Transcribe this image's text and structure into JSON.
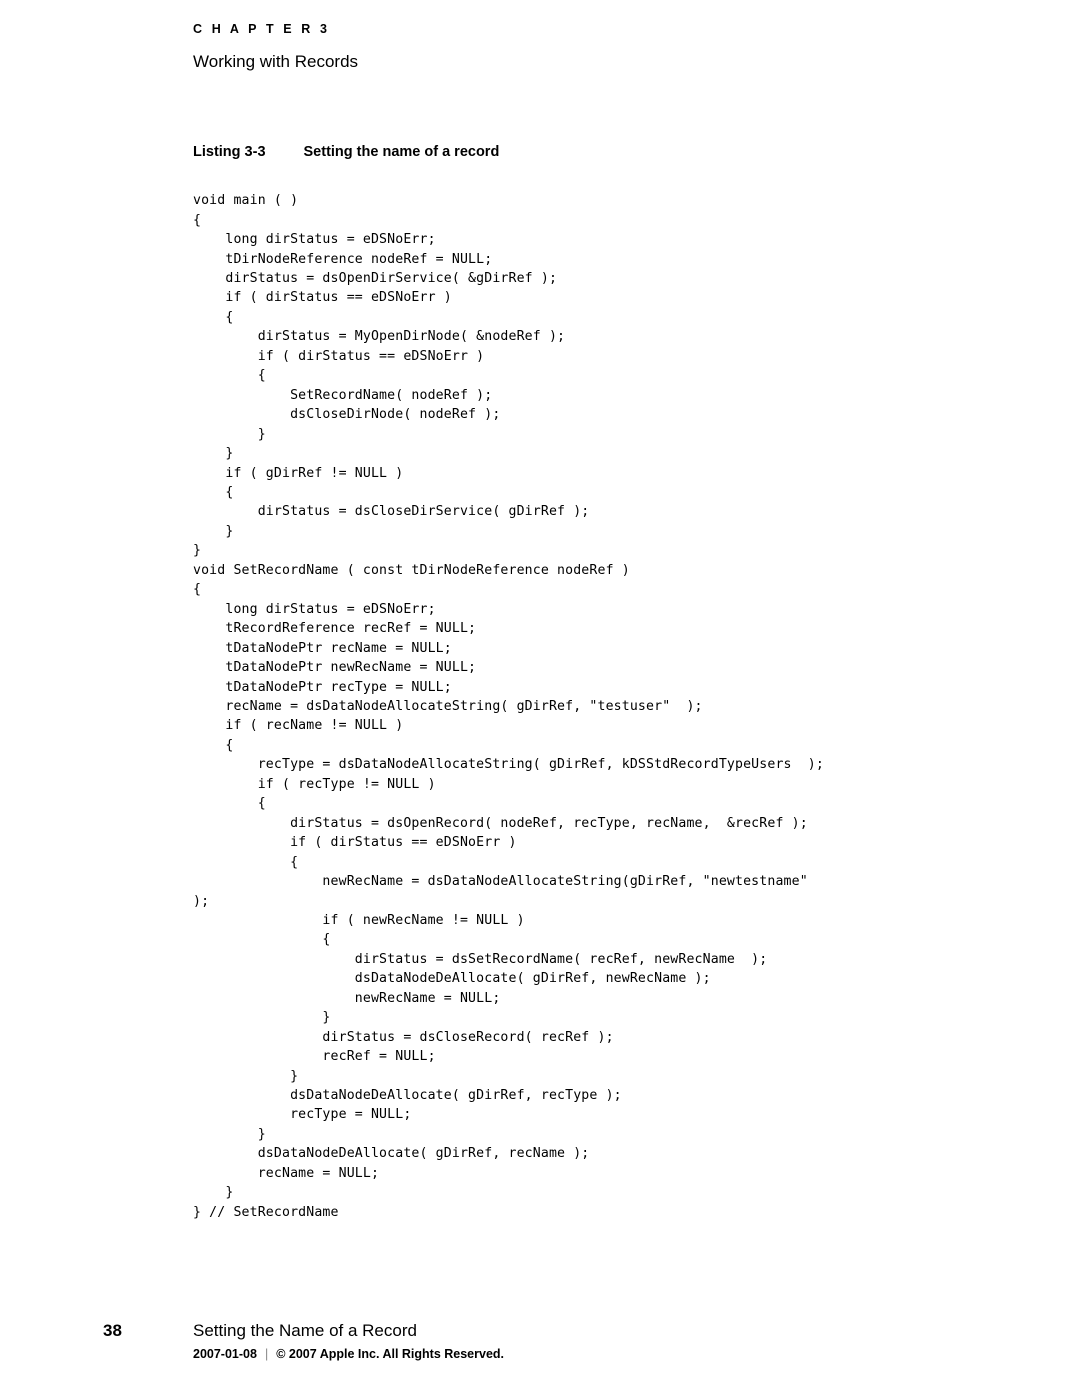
{
  "header": {
    "chapter_label": "C H A P T E R   3",
    "chapter_title": "Working with Records"
  },
  "listing": {
    "number": "Listing 3-3",
    "caption": "Setting the name of a record",
    "code": "void main ( )\n{\n    long dirStatus = eDSNoErr;\n    tDirNodeReference nodeRef = NULL;\n    dirStatus = dsOpenDirService( &gDirRef );\n    if ( dirStatus == eDSNoErr )\n    {\n        dirStatus = MyOpenDirNode( &nodeRef );\n        if ( dirStatus == eDSNoErr )\n        {\n            SetRecordName( nodeRef );\n            dsCloseDirNode( nodeRef );\n        }\n    }\n    if ( gDirRef != NULL )\n    {\n        dirStatus = dsCloseDirService( gDirRef );\n    }\n}\nvoid SetRecordName ( const tDirNodeReference nodeRef )\n{\n    long dirStatus = eDSNoErr;\n    tRecordReference recRef = NULL;\n    tDataNodePtr recName = NULL;\n    tDataNodePtr newRecName = NULL;\n    tDataNodePtr recType = NULL;\n    recName = dsDataNodeAllocateString( gDirRef, \"testuser\"  );\n    if ( recName != NULL )\n    {\n        recType = dsDataNodeAllocateString( gDirRef, kDSStdRecordTypeUsers  );\n        if ( recType != NULL )\n        {\n            dirStatus = dsOpenRecord( nodeRef, recType, recName,  &recRef );\n            if ( dirStatus == eDSNoErr )\n            {\n                newRecName = dsDataNodeAllocateString(gDirRef, \"newtestname\"\n);\n                if ( newRecName != NULL )\n                {\n                    dirStatus = dsSetRecordName( recRef, newRecName  );\n                    dsDataNodeDeAllocate( gDirRef, newRecName );\n                    newRecName = NULL;\n                }\n                dirStatus = dsCloseRecord( recRef );\n                recRef = NULL;\n            }\n            dsDataNodeDeAllocate( gDirRef, recType );\n            recType = NULL;\n        }\n        dsDataNodeDeAllocate( gDirRef, recName );\n        recName = NULL;\n    }\n} // SetRecordName"
  },
  "footer": {
    "page_number": "38",
    "title": "Setting the Name of a Record",
    "date": "2007-01-08",
    "separator": "|",
    "copyright": "© 2007 Apple Inc. All Rights Reserved."
  }
}
